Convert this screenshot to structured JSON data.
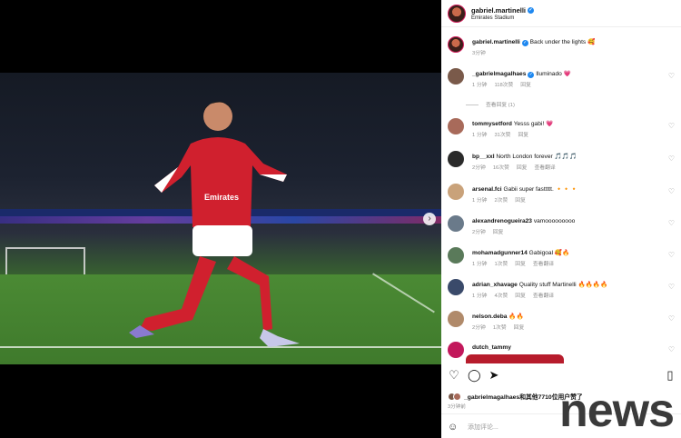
{
  "post": {
    "username": "gabriel.martinelli",
    "location": "Emirates Stadium",
    "caption": "Back under the lights 🥰",
    "caption_time": "3分钟"
  },
  "comments": [
    {
      "user": "_gabrielmagalhaes",
      "text": "Iluminado 💗",
      "time": "1 分钟",
      "likes": "118次赞",
      "reply": "回复",
      "translate": "",
      "view_replies": "查看回复 (1)",
      "avatar_color": "#7a5a4a"
    },
    {
      "user": "tommysetford",
      "text": "Yesss gabi! 💗",
      "time": "1 分钟",
      "likes": "31次赞",
      "reply": "回复",
      "translate": "",
      "avatar_color": "#a86a5a"
    },
    {
      "user": "bp__xxl",
      "text": "North London forever 🎵🎵🎵",
      "time": "2分钟",
      "likes": "16次赞",
      "reply": "回复",
      "translate": "查看翻译",
      "avatar_color": "#2a2a2a"
    },
    {
      "user": "arsenal.fci",
      "text": "Gabii super fasttttt. 🔸🔸🔸",
      "time": "1 分钟",
      "likes": "2次赞",
      "reply": "回复",
      "translate": "",
      "avatar_color": "#c9a27a"
    },
    {
      "user": "alexandrenogueira23",
      "text": "vamooooooooo",
      "time": "2分钟",
      "likes": "",
      "reply": "回复",
      "translate": "",
      "avatar_color": "#6a7a8a"
    },
    {
      "user": "mohamadgunner14",
      "text": "Gabigoal 🥰🔥",
      "time": "1 分钟",
      "likes": "1次赞",
      "reply": "回复",
      "translate": "查看翻译",
      "avatar_color": "#5a7a5a"
    },
    {
      "user": "adrian_xhavage",
      "text": "Quality stuff Martinelli 🔥🔥🔥🔥",
      "time": "1 分钟",
      "likes": "4次赞",
      "reply": "回复",
      "translate": "查看翻译",
      "avatar_color": "#3a4a6a"
    },
    {
      "user": "nelson.deba",
      "text": "🔥🔥",
      "time": "2分钟",
      "likes": "1次赞",
      "reply": "回复",
      "translate": "",
      "avatar_color": "#b08a6a"
    },
    {
      "user": "dutch_tammy",
      "text": "",
      "time": "",
      "likes": "",
      "reply": "",
      "translate": "",
      "avatar_color": "#c2185b"
    }
  ],
  "likes_line": {
    "text": "_gabrielmagalhaes和其他7710位用户赞了"
  },
  "date": "3分钟前",
  "add_comment_placeholder": "添加评论...",
  "watermark": "news",
  "colors": {
    "verified": "#1e88f0",
    "heart": "#999999",
    "arsenal_red": "#d0202e"
  }
}
